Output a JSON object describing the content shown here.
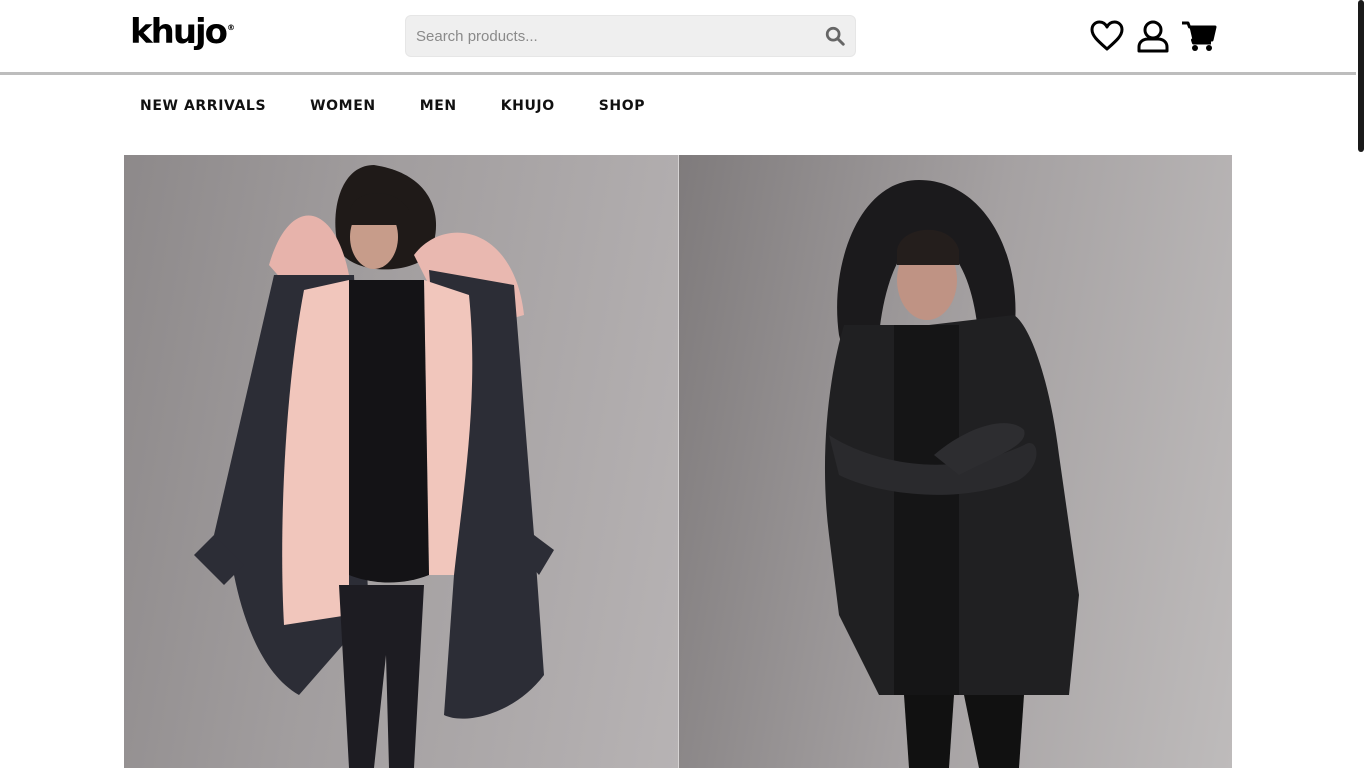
{
  "brand": {
    "name": "khujo",
    "mark": "®"
  },
  "search": {
    "placeholder": "Search products..."
  },
  "header_icons": [
    "heart-icon",
    "user-icon",
    "cart-icon"
  ],
  "nav": {
    "items": [
      {
        "label": "NEW ARRIVALS"
      },
      {
        "label": "WOMEN"
      },
      {
        "label": "MEN"
      },
      {
        "label": "KHUJO"
      },
      {
        "label": "SHOP"
      }
    ]
  },
  "hero": {
    "panels": [
      "left-model-parka-pink-fur",
      "right-model-black-hooded-coat"
    ]
  },
  "colors": {
    "text": "#111111",
    "search_bg": "#efefef",
    "rule": "#bdbdbd"
  }
}
